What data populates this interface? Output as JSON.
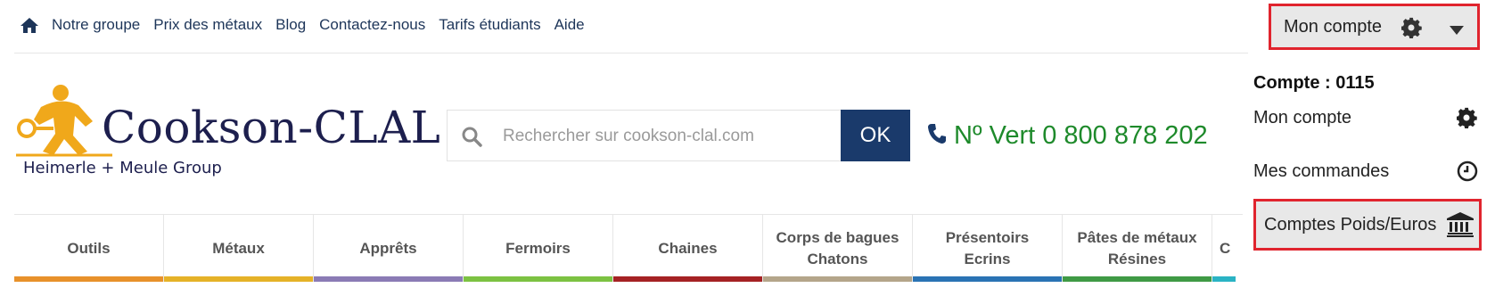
{
  "topnav": {
    "items": [
      "Notre groupe",
      "Prix des métaux",
      "Blog",
      "Contactez-nous",
      "Tarifs étudiants",
      "Aide"
    ]
  },
  "logo": {
    "brand": "Cookson-CLAL",
    "subtitle": "Heimerle + Meule Group"
  },
  "search": {
    "placeholder": "Rechercher sur cookson-clal.com",
    "button_label": "OK"
  },
  "phone": {
    "text": "Nº Vert 0 800 878 202"
  },
  "account": {
    "button_label": "Mon compte",
    "account_number": "Compte : 0115",
    "menu": [
      {
        "label": "Mon compte",
        "icon": "gear-icon"
      },
      {
        "label": "Mes commandes",
        "icon": "clock-icon"
      },
      {
        "label": "Comptes Poids/Euros",
        "icon": "bank-icon"
      }
    ]
  },
  "categories": [
    {
      "label": "Outils",
      "color": "#e8912b"
    },
    {
      "label": "Métaux",
      "color": "#e5b228"
    },
    {
      "label": "Apprêts",
      "color": "#8b7bb5"
    },
    {
      "label": "Fermoirs",
      "color": "#7cc242"
    },
    {
      "label": "Chaines",
      "color": "#a52224"
    },
    {
      "label": "Corps de bagues\nChatons",
      "color": "#b4a58a"
    },
    {
      "label": "Présentoirs\nEcrins",
      "color": "#2a73b4"
    },
    {
      "label": "Pâtes de métaux\nRésines",
      "color": "#3f9a45"
    },
    {
      "label": "C",
      "color": "#2ab3c4"
    }
  ]
}
